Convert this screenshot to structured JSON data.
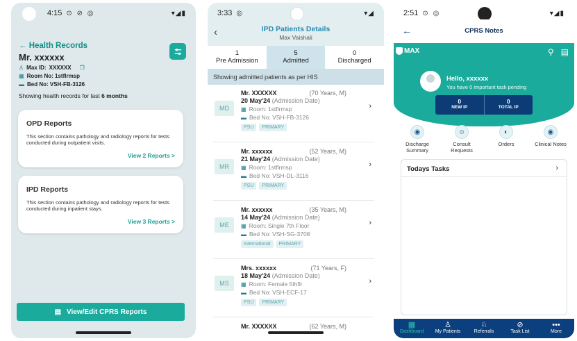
{
  "screens": {
    "health_records": {
      "status_time": "4:15",
      "status_left_icons": "⊙ ⊘ ◎",
      "status_right_icons": "▾◢▮",
      "back_label": "Health Records",
      "patient_name": "Mr. xxxxxx",
      "max_id_label": "Max ID:",
      "max_id_value": "XXXXXX",
      "room_no": "Room No: 1stflrmsp",
      "bed_no": "Bed No: VSH-FB-3126",
      "showing_prefix": "Showing health records for last",
      "showing_period": "6 months",
      "opd": {
        "title": "OPD Reports",
        "description": "This section contains pathology and radiology reports for tests conducted during outpatient visits.",
        "link": "View 2 Reports >"
      },
      "ipd": {
        "title": "IPD Reports",
        "description": "This section contains pathology and radiology reports for tests conducted during inpatient stays.",
        "link": "View 3 Reports >"
      },
      "cta_label": "View/Edit CPRS Reports"
    },
    "ipd_patients": {
      "status_time": "3:33",
      "status_left_icons": "◎",
      "status_right_icons": "▾◢",
      "title": "IPD Patients Details",
      "subtitle": "Max Vaishali",
      "tabs": [
        {
          "count": "1",
          "label": "Pre Admission"
        },
        {
          "count": "5",
          "label": "Admitted"
        },
        {
          "count": "0",
          "label": "Discharged"
        }
      ],
      "banner": "Showing admitted patients as per HIS",
      "patients": [
        {
          "initials": "MD",
          "name": "Mr. XXXXXX",
          "age": "(70 Years, M)",
          "date": "20 May'24",
          "date_note": "(Admission Date)",
          "room": "Room: 1stflrmsp",
          "bed": "Bed No: VSH-FB-3126",
          "tags": [
            "PSU",
            "PRIMARY"
          ]
        },
        {
          "initials": "MR",
          "name": "Mr. xxxxxx",
          "age": "(52 Years, M)",
          "date": "21 May'24",
          "date_note": "(Admission Date)",
          "room": "Room: 1stflrmsp",
          "bed": "Bed No: VSH-DL-3116",
          "tags": [
            "PSU",
            "PRIMARY"
          ]
        },
        {
          "initials": "ME",
          "name": "Mr. xxxxxx",
          "age": "(35 Years, M)",
          "date": "14 May'24",
          "date_note": "(Admission Date)",
          "room": "Room: Single 7th Floor",
          "bed": "Bed No: VSH-SG-3708",
          "tags": [
            "International",
            "PRIMARY"
          ]
        },
        {
          "initials": "MS",
          "name": "Mrs. xxxxxx",
          "age": "(71 Years, F)",
          "date": "18 May'24",
          "date_note": "(Admission Date)",
          "room": "Room: Female 5thflr",
          "bed": "Bed No: VSH-ECF-17",
          "tags": [
            "PSU",
            "PRIMARY"
          ]
        },
        {
          "initials": "",
          "name": "Mr. XXXXXX",
          "age": "(62 Years, M)",
          "date": "",
          "date_note": "",
          "room": "",
          "bed": "",
          "tags": []
        }
      ]
    },
    "cprs_notes": {
      "status_time": "2:51",
      "status_left_icons": "⊙ ◎",
      "status_right_icons": "▾◢▮",
      "title": "CPRS Notes",
      "brand": "MAX",
      "greeting": "Hello, xxxxxx",
      "pending": "You have 0 important task pending",
      "stats": [
        {
          "value": "0",
          "label": "NEW IP"
        },
        {
          "value": "0",
          "label": "TOTAL IP"
        }
      ],
      "actions": [
        {
          "icon": "discharge-summary-icon",
          "glyph": "◉",
          "label": "Discharge Summary"
        },
        {
          "icon": "consult-requests-icon",
          "glyph": "☺",
          "label": "Consult Requests"
        },
        {
          "icon": "orders-icon",
          "glyph": "◐",
          "label": "Orders"
        },
        {
          "icon": "clinical-notes-icon",
          "glyph": "◉",
          "label": "Clinical Notes"
        }
      ],
      "tasks_title": "Todays Tasks",
      "nav": [
        {
          "glyph": "▦",
          "label": "Dashboard"
        },
        {
          "glyph": "♙",
          "label": "My Patients"
        },
        {
          "glyph": "♘",
          "label": "Referrals"
        },
        {
          "glyph": "⊘",
          "label": "Task List"
        },
        {
          "glyph": "•••",
          "label": "More"
        }
      ]
    }
  },
  "colors": {
    "teal": "#1bab9c",
    "navy": "#0c3f7d",
    "blue_title": "#2a8bb0",
    "screen1_bg": "#dfe8ea"
  }
}
